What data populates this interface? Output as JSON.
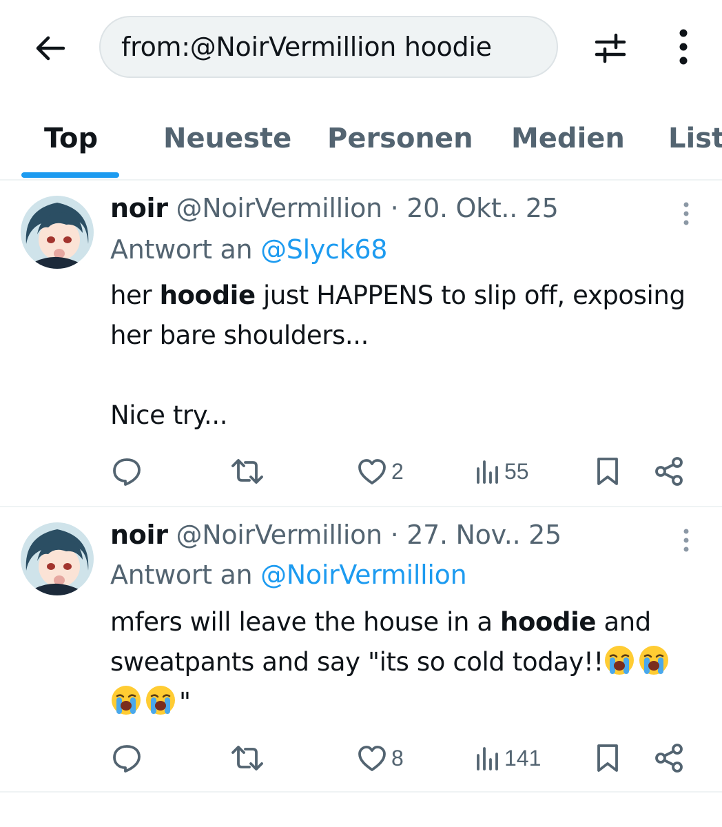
{
  "header": {
    "search_value": "from:@NoirVermillion hoodie",
    "icons": {
      "back": "arrow-left-icon",
      "filter": "sliders-icon",
      "more": "more-vertical-icon"
    }
  },
  "tabs": [
    {
      "label": "Top",
      "active": true
    },
    {
      "label": "Neueste",
      "active": false
    },
    {
      "label": "Personen",
      "active": false
    },
    {
      "label": "Medien",
      "active": false
    },
    {
      "label": "List",
      "active": false
    }
  ],
  "colors": {
    "accent": "#1d9bf0",
    "secondary_text": "#536471",
    "primary_text": "#0f1419",
    "divider": "#eff3f4"
  },
  "tweets": [
    {
      "name": "noir",
      "handle": "@NoirVermillion",
      "separator": "·",
      "date": "20. Okt.. 25",
      "reply_prefix": "Antwort an",
      "reply_to": "@Slyck68",
      "text": {
        "p1_before": "her ",
        "p1_bold": "hoodie",
        "p1_after": " just HAPPENS to slip off, exposing her bare shoulders...",
        "p2": "Nice try..."
      },
      "stats": {
        "replies": "",
        "reposts": "",
        "likes": "2",
        "views": "55"
      }
    },
    {
      "name": "noir",
      "handle": "@NoirVermillion",
      "separator": "·",
      "date": "27. Nov.. 25",
      "reply_prefix": "Antwort an",
      "reply_to": "@NoirVermillion",
      "text": {
        "p1_before": "mfers will leave the house in a ",
        "p1_bold": "hoodie",
        "p1_after": " and sweatpants and say \"its so cold today!!",
        "p1_end": "\"",
        "emoji": "loudly-crying-face"
      },
      "stats": {
        "replies": "",
        "reposts": "",
        "likes": "8",
        "views": "141"
      }
    }
  ]
}
